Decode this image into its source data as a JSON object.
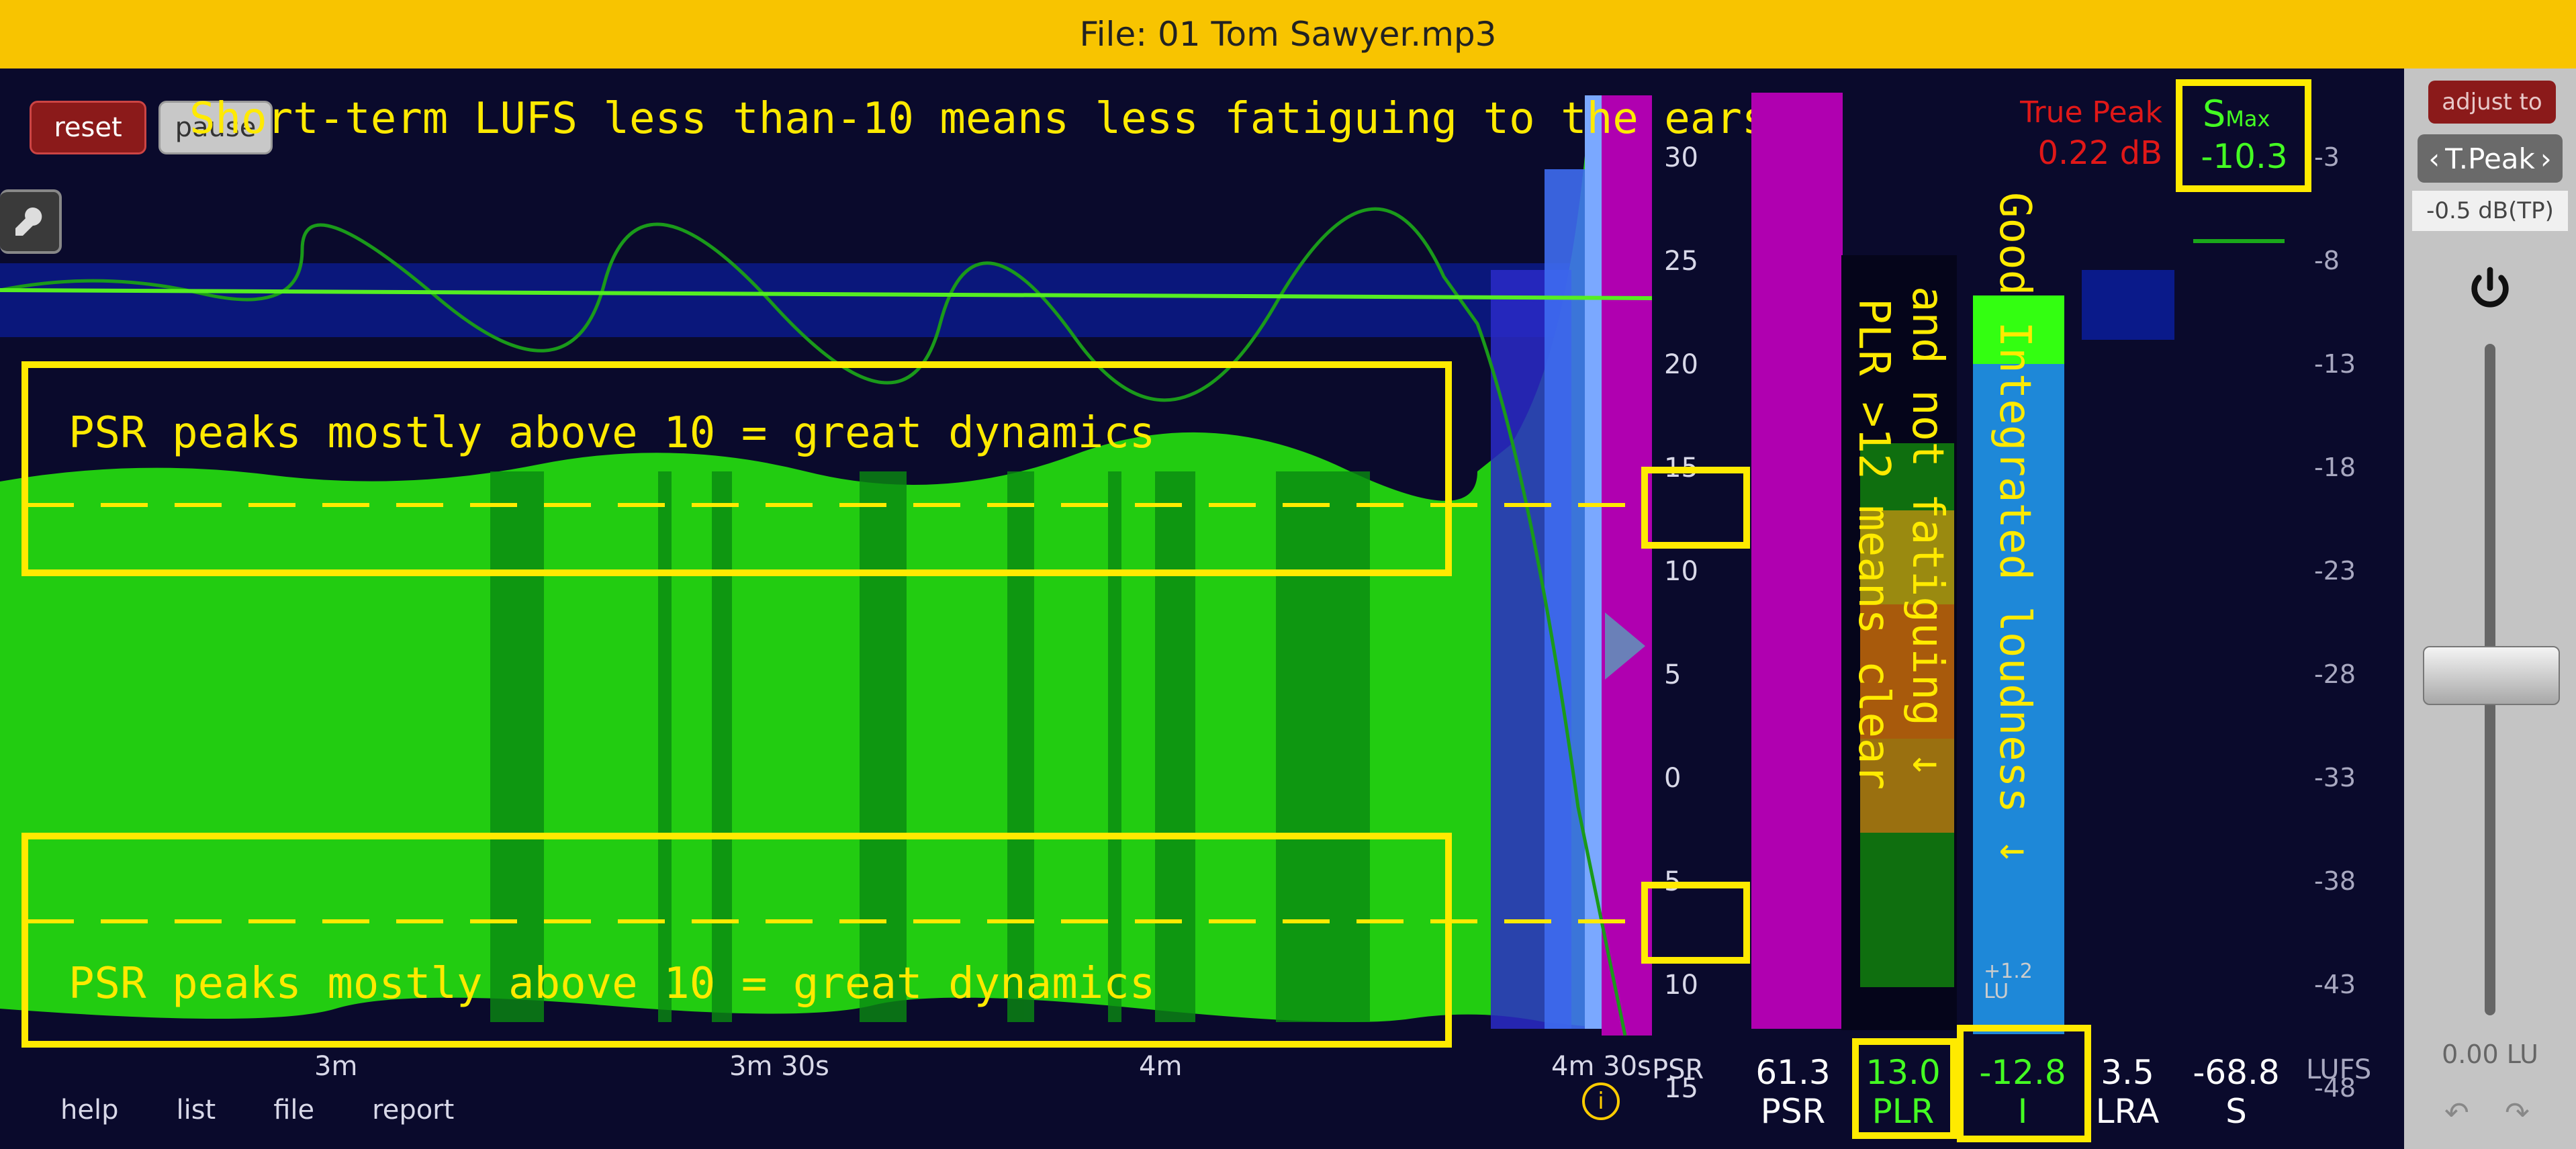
{
  "title": "File: 01 Tom Sawyer.mp3",
  "toolbar": {
    "reset": "reset",
    "pause": "pause"
  },
  "annotations": {
    "short_term": "Short-term LUFS less than-10 means less fatiguing to the ears →",
    "psr_top": "PSR peaks mostly above 10 = great dynamics",
    "psr_bottom": "PSR peaks mostly above 10 = great dynamics",
    "plr_line1": "PLR >12 means clear",
    "plr_line2": "and not fatiguing ↓",
    "integrated": "Good Integrated loudness ↓"
  },
  "psr_scale": [
    "30",
    "25",
    "20",
    "15",
    "10",
    "5",
    "0",
    "5",
    "10",
    "15"
  ],
  "lufs_scale": [
    "-3",
    "-8",
    "-13",
    "-18",
    "-23",
    "-28",
    "-33",
    "-38",
    "-43",
    "-48"
  ],
  "time_axis": [
    "3m",
    "3m 30s",
    "4m",
    "4m 30s"
  ],
  "axis_unit_psr": "PSR",
  "axis_unit_lufs": "LUFS",
  "true_peak": {
    "label": "True Peak",
    "value": "0.22 dB"
  },
  "smax": {
    "label": "S",
    "sub": "Max",
    "value": "-10.3"
  },
  "stats": [
    {
      "value": "61.3",
      "label": "PSR"
    },
    {
      "value": "13.0",
      "label": "PLR"
    },
    {
      "value": "-12.8",
      "label": "I"
    },
    {
      "value": "3.5",
      "label": "LRA"
    },
    {
      "value": "-68.8",
      "label": "S"
    }
  ],
  "lu_tag": "+1.2\nLU",
  "bottom_menu": [
    "help",
    "list",
    "file",
    "report"
  ],
  "right_panel": {
    "adjust": "adjust to",
    "mode": "T.Peak",
    "target": "-0.5 dB(TP)",
    "readout": "0.00 LU"
  },
  "colors": {
    "accent": "#ffea00",
    "green": "#33dd11",
    "magenta": "#b000b0",
    "blue": "#1e88d8",
    "title_bar": "#f8c400"
  }
}
